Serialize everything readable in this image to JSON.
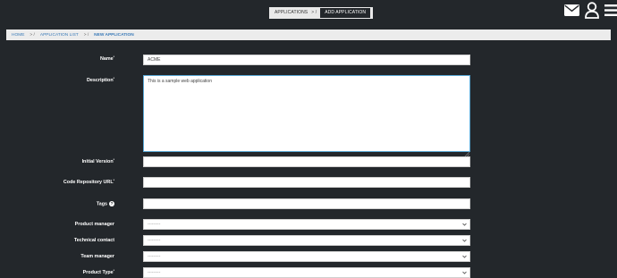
{
  "top_breadcrumb": {
    "items": [
      "APPLICATIONS",
      "ADD APPLICATION"
    ],
    "separator": "> /"
  },
  "top_icons": [
    "envelope-icon",
    "user-icon",
    "hamburger-menu-icon"
  ],
  "breadcrumb": {
    "home": "HOME",
    "list": "APPLICATION LIST",
    "current": "NEW APPLICATION",
    "sep": "> /"
  },
  "form": {
    "name": {
      "label": "Name",
      "required": "*",
      "value": "ACME"
    },
    "description": {
      "label": "Description",
      "required": "*",
      "value": "This is a sample web application"
    },
    "initial_version": {
      "label": "Initial Version",
      "required": "*",
      "value": ""
    },
    "repo_url": {
      "label": "Code Repository URL",
      "required": "*",
      "value": ""
    },
    "tags": {
      "label": "Tags",
      "help": "?",
      "value": ""
    },
    "product_manager": {
      "label": "Product manager",
      "selected": "---------"
    },
    "technical_contact": {
      "label": "Technical contact",
      "selected": "---------"
    },
    "team_manager": {
      "label": "Team manager",
      "selected": "---------"
    },
    "product_type": {
      "label": "Product Type",
      "required": "*",
      "selected": "---------"
    }
  },
  "colors": {
    "background": "#23272b",
    "link": "#3a7ab8",
    "focus_border": "#5aa9d6"
  }
}
